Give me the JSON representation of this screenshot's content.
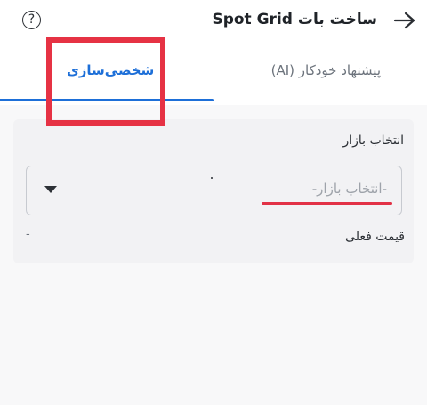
{
  "header": {
    "title": "ساخت بات Spot Grid",
    "help_symbol": "?",
    "icons": {
      "back": "arrow-right-icon",
      "help": "question-mark-circle-icon"
    }
  },
  "tabs": [
    {
      "label": "شخصی‌سازی",
      "active": true
    },
    {
      "label": "پیشنهاد خودکار (AI)",
      "active": false
    }
  ],
  "form": {
    "market_label": "انتخاب بازار",
    "market_placeholder": "-انتخاب بازار-",
    "current_price_label": "قیمت فعلی",
    "current_price_value": "-"
  },
  "colors": {
    "accent": "#1d6fd8",
    "annotation_red": "#e63244"
  }
}
